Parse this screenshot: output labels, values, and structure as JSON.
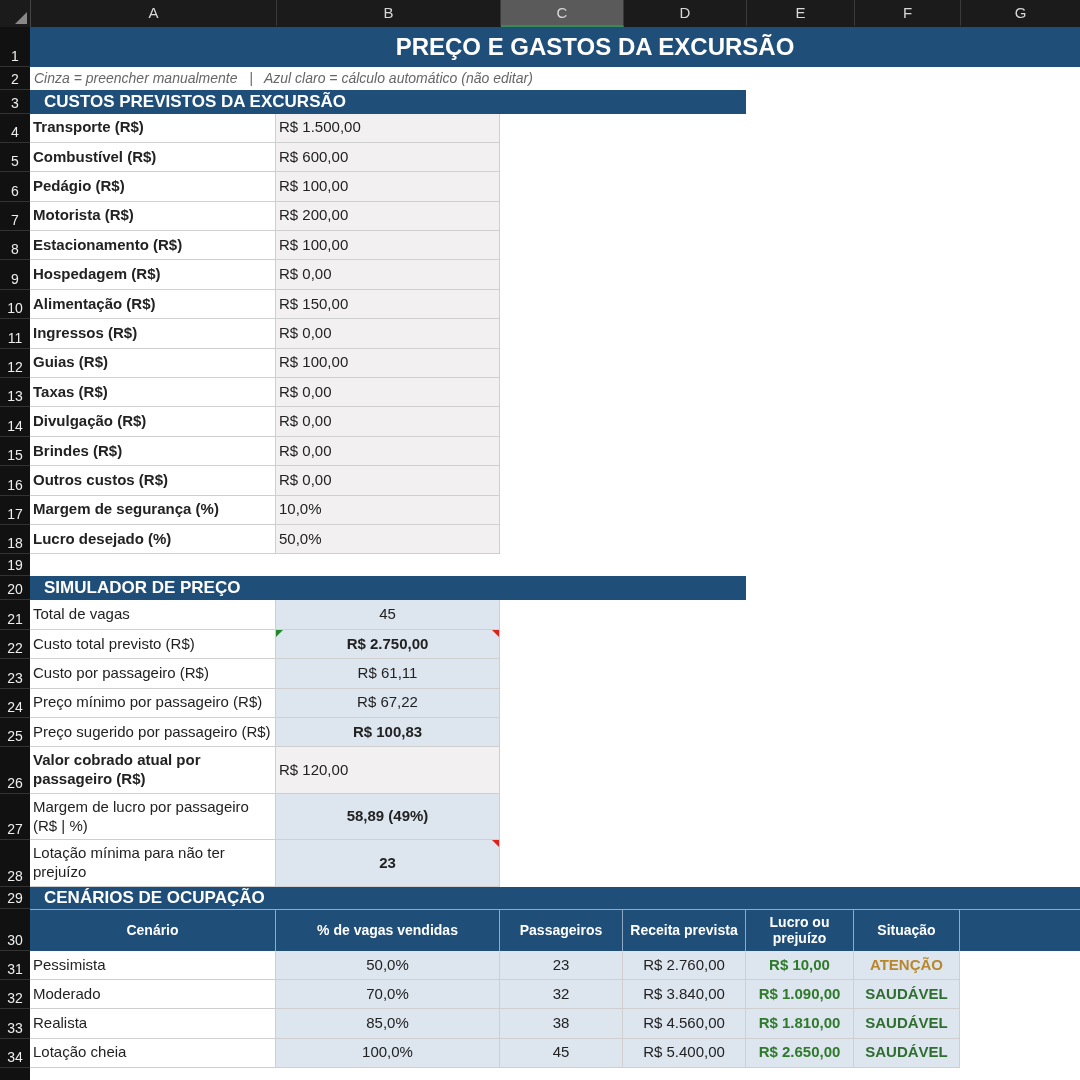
{
  "columns": [
    {
      "label": "A",
      "selected": false
    },
    {
      "label": "B",
      "selected": false
    },
    {
      "label": "C",
      "selected": true
    },
    {
      "label": "D",
      "selected": false
    },
    {
      "label": "E",
      "selected": false
    },
    {
      "label": "F",
      "selected": false
    },
    {
      "label": "G",
      "selected": false
    }
  ],
  "row_numbers": [
    "1",
    "2",
    "3",
    "4",
    "5",
    "6",
    "7",
    "8",
    "9",
    "10",
    "11",
    "12",
    "13",
    "14",
    "15",
    "16",
    "17",
    "18",
    "19",
    "20",
    "21",
    "22",
    "23",
    "24",
    "25",
    "26",
    "27",
    "28",
    "29",
    "30",
    "31",
    "32",
    "33",
    "34"
  ],
  "title": "PREÇO E GASTOS DA EXCURSÃO",
  "legend": "Cinza = preencher manualmente   |   Azul claro = cálculo automático (não editar)",
  "costs": {
    "title": "CUSTOS PREVISTOS DA EXCURSÃO",
    "items": [
      {
        "label": "Transporte (R$)",
        "value": "R$ 1.500,00"
      },
      {
        "label": "Combustível (R$)",
        "value": "R$ 600,00"
      },
      {
        "label": "Pedágio (R$)",
        "value": "R$ 100,00"
      },
      {
        "label": "Motorista (R$)",
        "value": "R$ 200,00"
      },
      {
        "label": "Estacionamento (R$)",
        "value": "R$ 100,00"
      },
      {
        "label": "Hospedagem (R$)",
        "value": "R$ 0,00"
      },
      {
        "label": "Alimentação (R$)",
        "value": "R$ 150,00"
      },
      {
        "label": "Ingressos (R$)",
        "value": "R$ 0,00"
      },
      {
        "label": "Guias (R$)",
        "value": "R$ 100,00"
      },
      {
        "label": "Taxas (R$)",
        "value": "R$ 0,00"
      },
      {
        "label": "Divulgação (R$)",
        "value": "R$ 0,00"
      },
      {
        "label": "Brindes (R$)",
        "value": "R$ 0,00"
      },
      {
        "label": "Outros custos (R$)",
        "value": "R$ 0,00"
      },
      {
        "label": "Margem de segurança (%)",
        "value": "10,0%"
      },
      {
        "label": "Lucro desejado (%)",
        "value": "50,0%"
      }
    ]
  },
  "simulator": {
    "title": "SIMULADOR DE PREÇO",
    "items": [
      {
        "kind": "calc",
        "label": "Total de vagas",
        "value": "45",
        "bold": false,
        "comment": false,
        "warning": false
      },
      {
        "kind": "calc",
        "label": "Custo total previsto (R$)",
        "value": "R$ 2.750,00",
        "bold": true,
        "comment": true,
        "warning": true
      },
      {
        "kind": "calc",
        "label": "Custo por passageiro (R$)",
        "value": "R$ 61,11",
        "bold": false,
        "comment": false,
        "warning": false
      },
      {
        "kind": "calc",
        "label": "Preço mínimo por passageiro (R$)",
        "value": "R$ 67,22",
        "bold": false,
        "comment": false,
        "warning": false
      },
      {
        "kind": "calc",
        "label": "Preço sugerido por passageiro (R$)",
        "value": "R$ 100,83",
        "bold": true,
        "comment": false,
        "warning": false
      },
      {
        "kind": "input",
        "label": "Valor cobrado atual por passageiro (R$)",
        "value": "R$ 120,00",
        "bold": false,
        "comment": false,
        "warning": false
      },
      {
        "kind": "calc",
        "label": "Margem de lucro por passageiro (R$ | %)",
        "value": "58,89  (49%)",
        "bold": true,
        "comment": false,
        "warning": false
      },
      {
        "kind": "calc",
        "label": "Lotação mínima para não ter prejuízo",
        "value": "23",
        "bold": true,
        "comment": true,
        "warning": false
      }
    ]
  },
  "scenarios": {
    "title": "CENÁRIOS DE OCUPAÇÃO",
    "columns": [
      "Cenário",
      "% de vagas vendidas",
      "Passageiros",
      "Receita prevista",
      "Lucro ou prejuízo",
      "Situação"
    ],
    "rows": [
      {
        "scenario": "Pessimista",
        "share": "50,0%",
        "passengers": "23",
        "revenue": "R$ 2.760,00",
        "result": "R$ 10,00",
        "status": "ATENÇÃO",
        "color": "#b8862b"
      },
      {
        "scenario": "Moderado",
        "share": "70,0%",
        "passengers": "32",
        "revenue": "R$ 3.840,00",
        "result": "R$ 1.090,00",
        "status": "SAUDÁVEL",
        "color": "#2f6e2f"
      },
      {
        "scenario": "Realista",
        "share": "85,0%",
        "passengers": "38",
        "revenue": "R$ 4.560,00",
        "result": "R$ 1.810,00",
        "status": "SAUDÁVEL",
        "color": "#2f6e2f"
      },
      {
        "scenario": "Lotação cheia",
        "share": "100,0%",
        "passengers": "45",
        "revenue": "R$ 5.400,00",
        "result": "R$ 2.650,00",
        "status": "SAUDÁVEL",
        "color": "#2f6e2f"
      }
    ]
  }
}
